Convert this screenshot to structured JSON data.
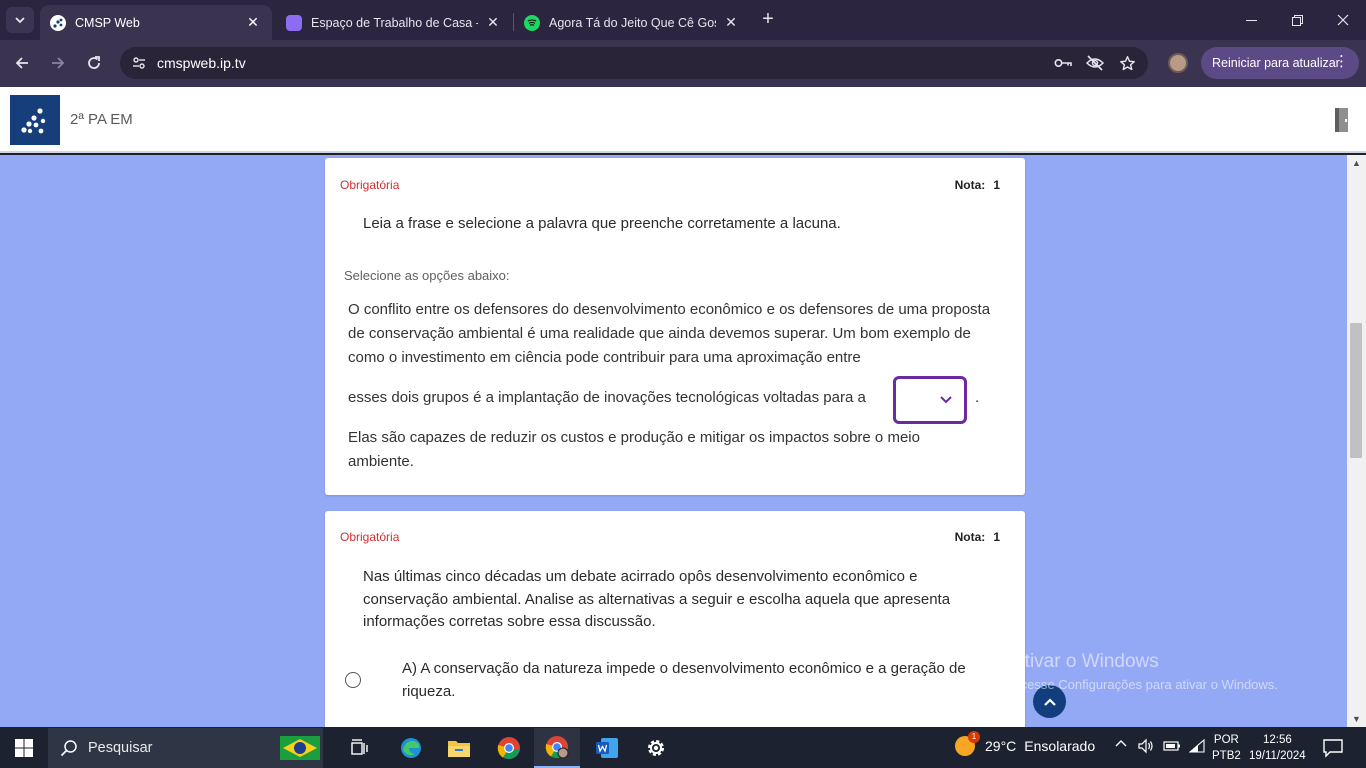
{
  "browser": {
    "tabs": [
      {
        "title": "CMSP Web",
        "active": true
      },
      {
        "title": "Espaço de Trabalho de Casa - Sl",
        "active": false
      },
      {
        "title": "Agora Tá do Jeito Que Cê Gosta",
        "active": false
      }
    ],
    "url": "cmspweb.ip.tv",
    "update_button": "Reiniciar para atualizar"
  },
  "page": {
    "title": "2ª PA EM"
  },
  "questions": [
    {
      "required": "Obrigatória",
      "nota_label": "Nota:",
      "nota_value": "1",
      "prompt": "Leia a frase e selecione a palavra que preenche corretamente a lacuna.",
      "hint": "Selecione as opções abaixo:",
      "paragraph_part1": "O conflito entre os defensores do desenvolvimento econômico e os defensores de uma proposta de conservação ambiental é uma realidade que ainda devemos superar. Um bom exemplo de como o investimento em ciência pode contribuir para uma aproximação entre",
      "paragraph_part2": "esses dois grupos é a implantação de inovações tecnológicas voltadas para a",
      "paragraph_after_blank": ".",
      "paragraph_part3": "Elas são capazes de reduzir os custos e produção e mitigar os impactos sobre o meio ambiente.",
      "blank_value": ""
    },
    {
      "required": "Obrigatória",
      "nota_label": "Nota:",
      "nota_value": "1",
      "prompt": "Nas últimas cinco décadas um debate acirrado opôs desenvolvimento econômico e conservação ambiental. Analise as alternativas a seguir e escolha aquela que apresenta informações corretas sobre essa discussão.",
      "options": [
        {
          "text": "A) A conservação da natureza impede o desenvolvimento econômico e a geração de riqueza."
        }
      ]
    }
  ],
  "watermark": {
    "line1": "Ativar o Windows",
    "line2": "Acesse Configurações para ativar o Windows."
  },
  "taskbar": {
    "search_placeholder": "Pesquisar",
    "weather_temp": "29°C",
    "weather_text": "Ensolarado",
    "weather_badge": "1",
    "lang_line1": "POR",
    "lang_line2": "PTB2",
    "time": "12:56",
    "date": "19/11/2024"
  },
  "colors": {
    "content_bg": "#94a9f5",
    "required_red": "#d32f2f",
    "select_border": "#6a2aa0",
    "logo_blue": "#163e7a"
  }
}
